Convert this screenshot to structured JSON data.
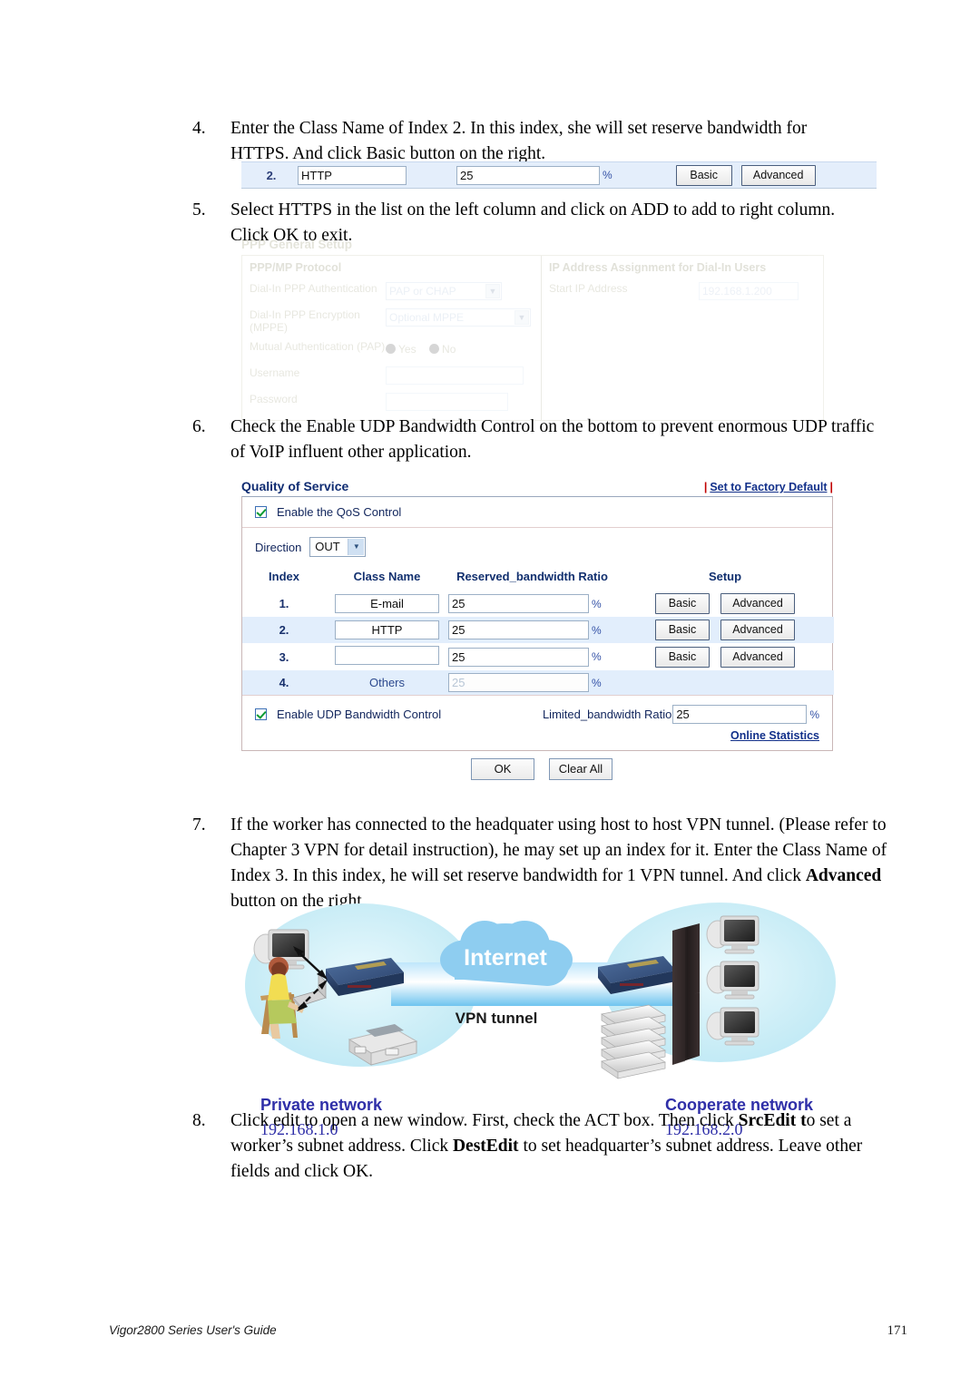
{
  "document": {
    "footer_text": "Vigor2800 Series User's Guide",
    "page_number": "171"
  },
  "steps": {
    "step4": {
      "number": "4.",
      "text": "Enter the Class Name of Index 2. In this index, she will set reserve bandwidth for HTTPS. And click Basic button on the right."
    },
    "step5": {
      "number": "5.",
      "text": "Select HTTPS in the list on the left column and click on ADD to add to right column. Click OK to exit."
    },
    "step6": {
      "number": "6.",
      "text": "Check the Enable UDP Bandwidth Control on the bottom to prevent enormous UDP traffic of VoIP influent other application."
    },
    "step7": {
      "number": "7.",
      "text_part1": "If the worker has connected to the headquater using host to host VPN tunnel. (Please refer to Chapter 3 VPN for detail instruction), he may set up an index for it. Enter the Class Name of Index 3. In this index, he will set reserve bandwidth for 1 VPN tunnel. And click ",
      "bold1": "Advanced",
      "text_part2": " button on the right."
    },
    "step8": {
      "number": "8.",
      "text_part1": "Click edit to open a new window. First, check the ACT box. Then click ",
      "bold1": "SrcEdit t",
      "text_part2": "o set a worker’s subnet address. Click ",
      "bold2": "DestEdit",
      "text_part3": " to set headquarter’s subnet address. Leave other fields and click OK."
    }
  },
  "step4_widget": {
    "index": "2.",
    "class_name": "HTTP",
    "ratio": "25",
    "percent": "%",
    "basic_label": "Basic",
    "advanced_label": "Advanced"
  },
  "ppp_panel": {
    "title": "PPP General Setup",
    "left_section": "PPP/MP Protocol",
    "right_section": "IP Address Assignment for Dial-In Users",
    "fields": {
      "auth_label": "Dial-In PPP Authentication",
      "auth_value": "PAP or CHAP",
      "encryption_label": "Dial-In PPP Encryption (MPPE)",
      "encryption_value": "Optional MPPE",
      "mutual_label": "Mutual Authentication (PAP)",
      "mutual_yes": "Yes",
      "mutual_no": "No",
      "username_label": "Username",
      "username_value": "",
      "password_label": "Password",
      "password_value": "",
      "start_ip_label": "Start IP Address",
      "start_ip_value": "192.168.1.200"
    }
  },
  "qos": {
    "title": "Quality of Service",
    "factory_default_link": "Set to Factory Default",
    "factory_bar": "|",
    "enable_qos_label": "Enable the QoS Control",
    "direction_label": "Direction",
    "direction_value": "OUT",
    "columns": {
      "index": "Index",
      "class_name": "Class Name",
      "ratio": "Reserved_bandwidth Ratio",
      "setup": "Setup"
    },
    "rows": [
      {
        "index": "1.",
        "class_name": "E-mail",
        "ratio": "25",
        "percent": "%",
        "basic": "Basic",
        "advanced": "Advanced",
        "editable": true
      },
      {
        "index": "2.",
        "class_name": "HTTP",
        "ratio": "25",
        "percent": "%",
        "basic": "Basic",
        "advanced": "Advanced",
        "editable": true
      },
      {
        "index": "3.",
        "class_name": "",
        "ratio": "25",
        "percent": "%",
        "basic": "Basic",
        "advanced": "Advanced",
        "editable": true
      },
      {
        "index": "4.",
        "class_name": "Others",
        "ratio": "25",
        "percent": "%",
        "basic": "",
        "advanced": "",
        "editable": false
      }
    ],
    "enable_udp_label": "Enable UDP Bandwidth Control",
    "limited_ratio_label": "Limited_bandwidth Ratio",
    "limited_ratio_value": "25",
    "limited_percent": "%",
    "online_statistics": "Online Statistics",
    "ok_label": "OK",
    "clear_all_label": "Clear All"
  },
  "diagram": {
    "internet_label": "Internet",
    "vpn_tunnel_label": "VPN tunnel",
    "private_network_label": "Private network",
    "private_network_ip": "192.168.1.0",
    "cooperate_network_label": "Cooperate network",
    "cooperate_network_ip": "192.168.2.0"
  },
  "colors": {
    "accent_blue": "#12308a",
    "header_blue": "#0f2c72",
    "link_red": "#c10000",
    "row_alt": "#e2eefc",
    "check_green": "#0a9b32",
    "diagram_cloud": "#8ecdf0",
    "diagram_halo": "#cdeef7",
    "diagram_text": "#2f2fa8"
  }
}
